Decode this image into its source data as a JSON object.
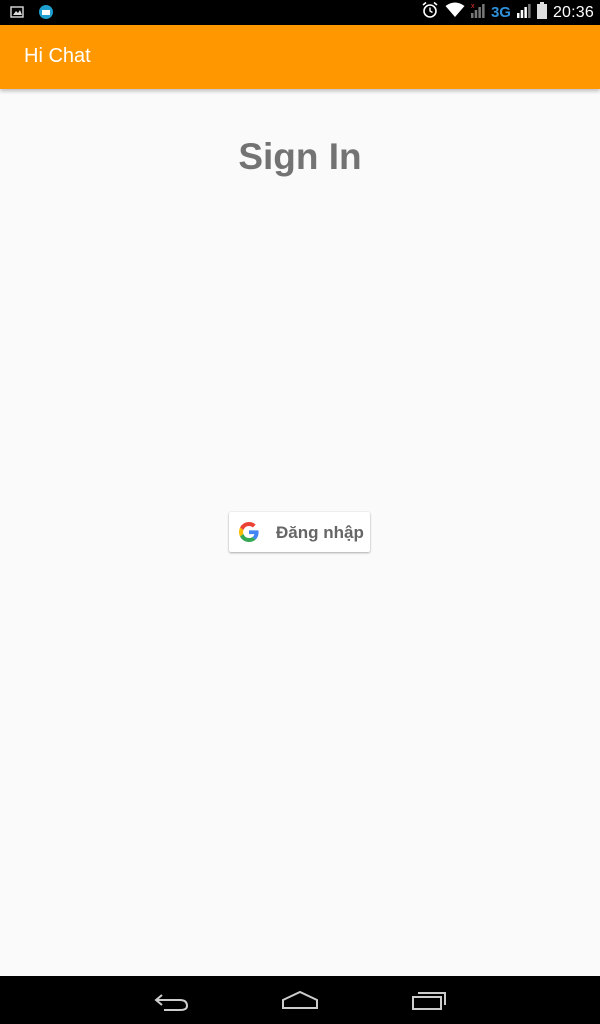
{
  "status_bar": {
    "time": "20:36",
    "network": "3G",
    "icons": [
      "image-notification-icon",
      "app-notification-icon",
      "alarm-icon",
      "wifi-icon",
      "signal-icon",
      "signal-icon-2",
      "battery-icon"
    ]
  },
  "app_bar": {
    "title": "Hi Chat",
    "color": "#ff9800"
  },
  "main": {
    "title": "Sign In",
    "google_button_label": "Đăng nhập"
  },
  "nav_bar": {
    "buttons": [
      "back-icon",
      "home-icon",
      "recents-icon"
    ]
  }
}
